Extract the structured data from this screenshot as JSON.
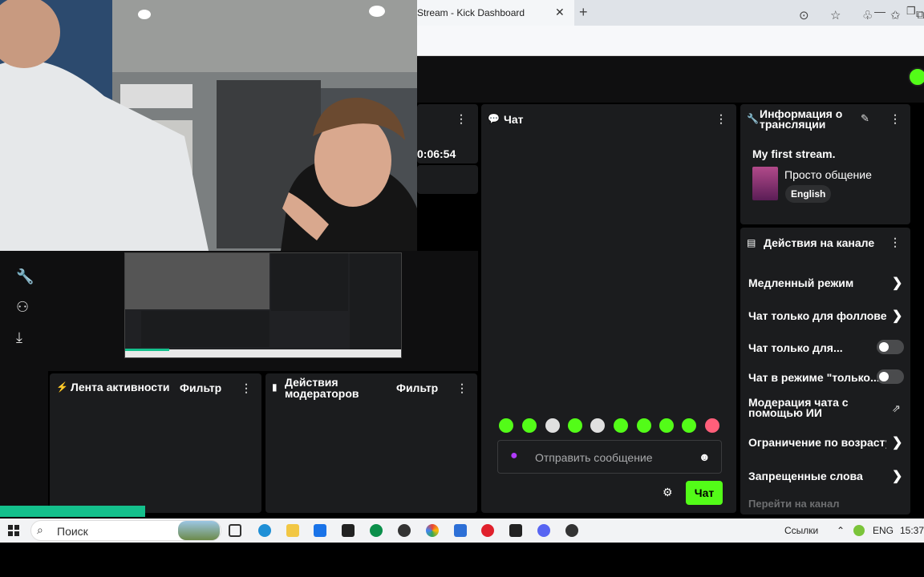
{
  "browser": {
    "tab_title": "Stream - Kick Dashboard",
    "tab_close": "✕",
    "new_tab": "+"
  },
  "stream": {
    "timer": "0:06:54"
  },
  "chat": {
    "title": "Чат",
    "placeholder": "Отправить сообщение",
    "send_label": "Чат",
    "accent": "#53fc18"
  },
  "stream_info": {
    "title": "Информация о трансляции",
    "stream_title": "My first stream.",
    "category": "Просто общение",
    "language": "English"
  },
  "channel_actions": {
    "title": "Действия на канале",
    "items": [
      {
        "label": "Медленный режим",
        "control": "chevron"
      },
      {
        "label": "Чат только для фолловеро",
        "control": "chevron"
      },
      {
        "label": "Чат только для...",
        "control": "toggle",
        "on": false
      },
      {
        "label": "Чат в режиме \"только...",
        "control": "toggle",
        "on": false
      },
      {
        "label": "Модерация чата с помощью ИИ",
        "control": "external"
      },
      {
        "label": "Ограничение по возрасту",
        "control": "chevron"
      },
      {
        "label": "Запрещенные слова",
        "control": "chevron"
      }
    ],
    "goto_channel": "Перейти на канал"
  },
  "activity": {
    "title": "Лента активности",
    "filter": "Фильтр"
  },
  "moderators": {
    "title": "Действия модераторов",
    "filter": "Фильтр"
  },
  "taskbar": {
    "search": "Поиск",
    "links": "Ссылки",
    "lang": "ENG",
    "time": "15:37"
  }
}
